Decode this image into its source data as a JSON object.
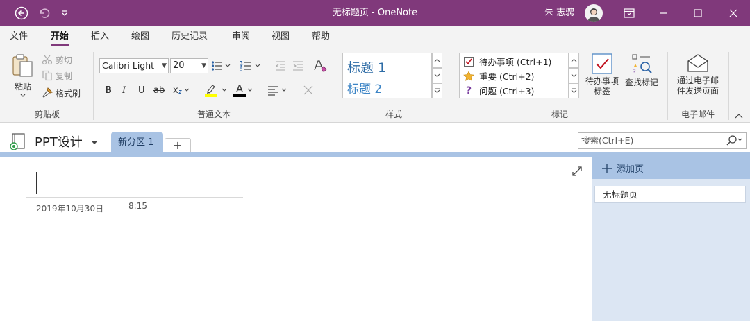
{
  "window": {
    "title": "无标题页 - OneNote",
    "user_name": "朱 志骋",
    "accent_color": "#80397b"
  },
  "menu": {
    "tabs": [
      "文件",
      "开始",
      "插入",
      "绘图",
      "历史记录",
      "审阅",
      "视图",
      "帮助"
    ],
    "active_tab": "开始"
  },
  "ribbon": {
    "clipboard": {
      "label": "剪贴板",
      "paste": "粘贴",
      "cut": "剪切",
      "copy": "复制",
      "format_painter": "格式刷"
    },
    "basic_text": {
      "label": "普通文本",
      "font_name": "Calibri Light",
      "font_size": "20",
      "bold": "B",
      "italic": "I",
      "underline": "U",
      "strikethrough": "ab",
      "subscript": "x",
      "font_color_letter": "A",
      "highlight_color": "#ffff00",
      "font_color": "#000000"
    },
    "styles": {
      "label": "样式",
      "items": [
        "标题 1",
        "标题 2"
      ]
    },
    "tags": {
      "label": "标记",
      "items": [
        "待办事项 (Ctrl+1)",
        "重要 (Ctrl+2)",
        "问题 (Ctrl+3)"
      ],
      "todo_tag": "待办事项\n标签",
      "find_tags": "查找标记"
    },
    "email": {
      "label": "电子邮件",
      "email_page": "通过电子邮\n件发送页面"
    }
  },
  "notebook": {
    "name": "PPT设计",
    "section_tab": "新分区 1",
    "add_tab": "+",
    "search_placeholder": "搜索(Ctrl+E)"
  },
  "page": {
    "date": "2019年10月30日",
    "time": "8:15"
  },
  "page_list": {
    "add_page": "添加页",
    "items": [
      "无标题页"
    ]
  }
}
